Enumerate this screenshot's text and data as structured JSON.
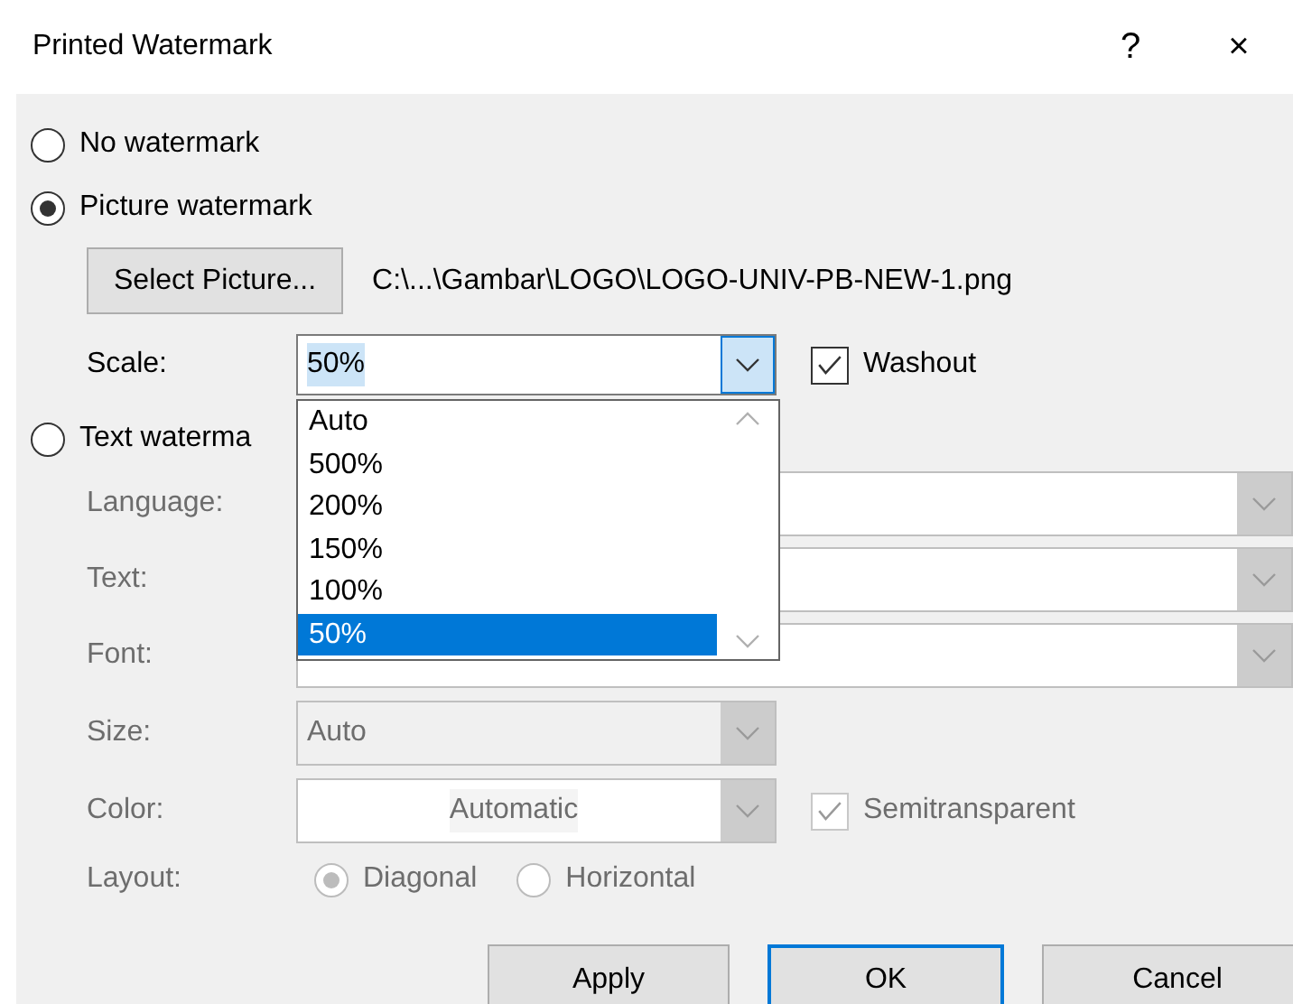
{
  "window": {
    "title": "Printed Watermark",
    "help": "?",
    "close": "×"
  },
  "options": [
    {
      "label": "No watermark",
      "selected": false
    },
    {
      "label": "Picture watermark",
      "selected": true
    },
    {
      "label": "Text waterma",
      "selected": false
    }
  ],
  "picture": {
    "select_button": "Select Picture...",
    "path": "C:\\...\\Gambar\\LOGO\\LOGO-UNIV-PB-NEW-1.png",
    "scale_label": "Scale:",
    "scale_value": "50%",
    "washout": {
      "label": "Washout",
      "checked": true
    },
    "scale_list": [
      {
        "label": "Auto",
        "selected": false
      },
      {
        "label": "500%",
        "selected": false
      },
      {
        "label": "200%",
        "selected": false
      },
      {
        "label": "150%",
        "selected": false
      },
      {
        "label": "100%",
        "selected": false
      },
      {
        "label": "50%",
        "selected": true
      }
    ]
  },
  "text_settings": {
    "disabled": true,
    "language_label": "Language:",
    "text_label": "Text:",
    "font_label": "Font:",
    "size_label": "Size:",
    "size_value": "Auto",
    "color_label": "Color:",
    "color_value": "Automatic",
    "semitransparent": {
      "label": "Semitransparent",
      "checked": true
    },
    "layout_label": "Layout:",
    "layouts": [
      {
        "label": "Diagonal",
        "selected": true
      },
      {
        "label": "Horizontal",
        "selected": false
      }
    ]
  },
  "buttons": [
    {
      "label": "Apply",
      "default": false
    },
    {
      "label": "OK",
      "default": true
    },
    {
      "label": "Cancel",
      "default": false
    }
  ]
}
